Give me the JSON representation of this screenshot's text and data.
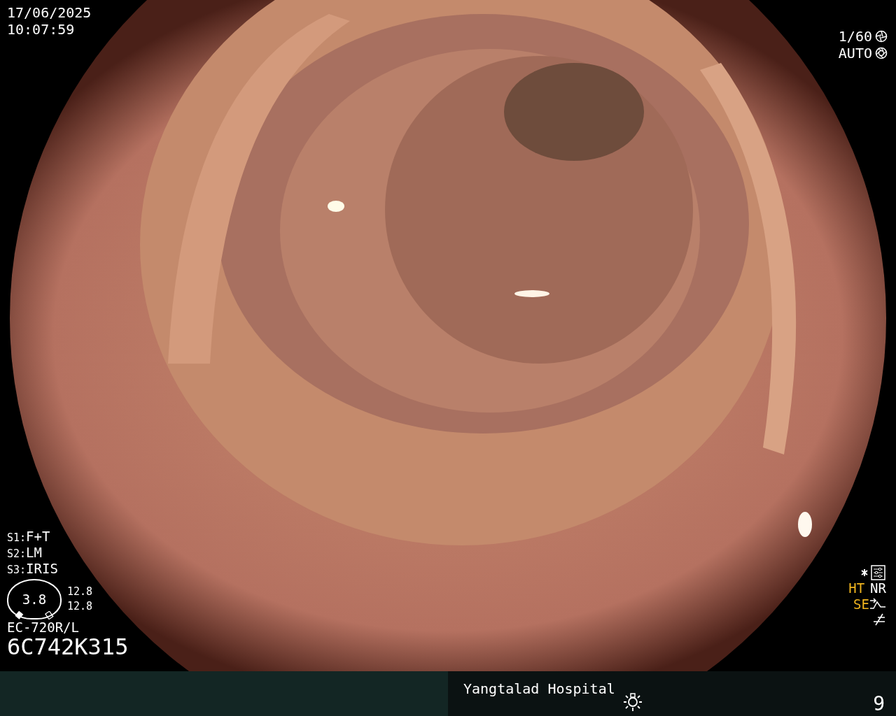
{
  "datetime": {
    "date": "17/06/2025",
    "time": "10:07:59"
  },
  "shutter": {
    "speed": "1/60",
    "iris": "AUTO"
  },
  "scope_buttons": [
    {
      "label": "S1:",
      "value": "F+T"
    },
    {
      "label": "S2:",
      "value": "LM"
    },
    {
      "label": "S3:",
      "value": "IRIS"
    }
  ],
  "gauge": {
    "value": "3.8",
    "readings": [
      "12.8",
      "12.8"
    ]
  },
  "scope_model": "EC-720R/L",
  "serial": "6C742K315",
  "image_settings": [
    {
      "label": "HT",
      "active": true
    },
    {
      "label": "NR",
      "active": false
    }
  ],
  "structure_enhancement": {
    "label": "SE",
    "active": true
  },
  "footer": {
    "hospital": "Yangtalad Hospital",
    "counter": "9"
  }
}
